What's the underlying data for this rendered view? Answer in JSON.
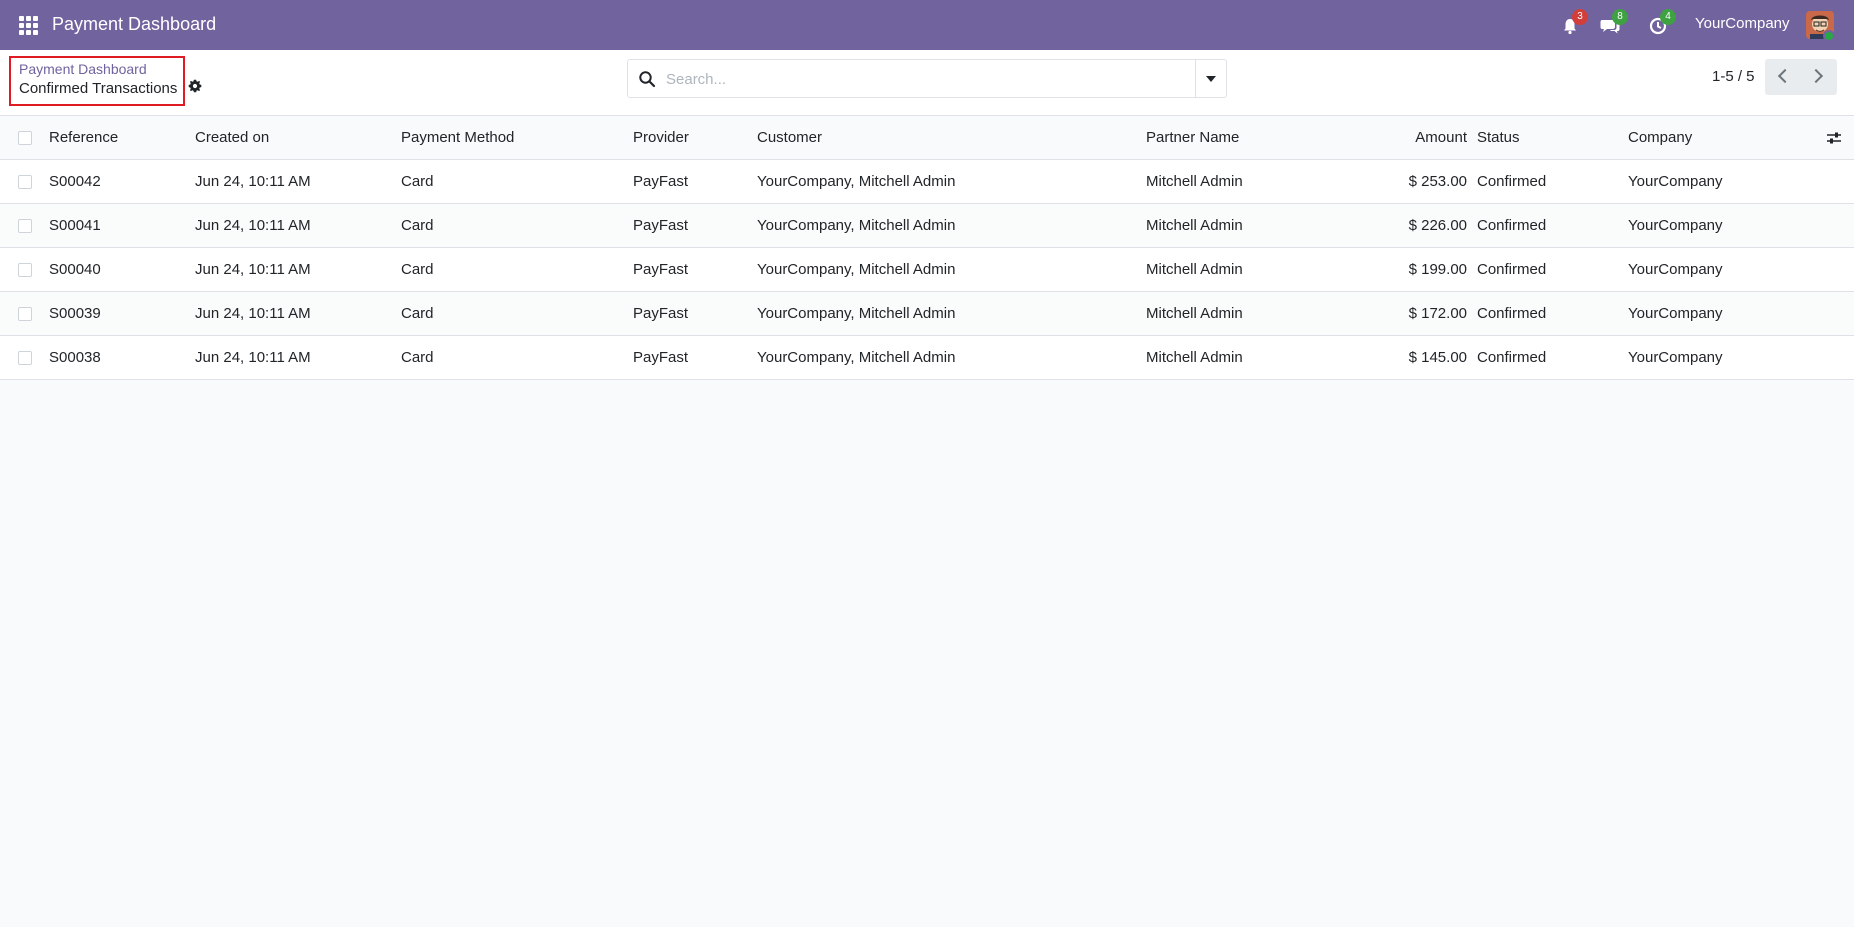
{
  "navbar": {
    "app_title": "Payment Dashboard",
    "icons": [
      "apps-icon",
      "bell-icon",
      "chat-icon",
      "clock-icon"
    ],
    "notifications_count": "3",
    "messages_count": "8",
    "activities_count": "4",
    "company": "YourCompany",
    "bg_color": "#71639e"
  },
  "breadcrumb": {
    "parent": "Payment Dashboard",
    "current": "Confirmed Transactions"
  },
  "search": {
    "placeholder": "Search...",
    "value": ""
  },
  "pager": {
    "value": "1-5 / 5"
  },
  "table": {
    "columns": [
      "Reference",
      "Created on",
      "Payment Method",
      "Provider",
      "Customer",
      "Partner Name",
      "Amount",
      "Status",
      "Company"
    ],
    "rows": [
      {
        "reference": "S00042",
        "created_on": "Jun 24, 10:11 AM",
        "payment_method": "Card",
        "provider": "PayFast",
        "customer": "YourCompany, Mitchell Admin",
        "partner_name": "Mitchell Admin",
        "amount": "$ 253.00",
        "status": "Confirmed",
        "company": "YourCompany"
      },
      {
        "reference": "S00041",
        "created_on": "Jun 24, 10:11 AM",
        "payment_method": "Card",
        "provider": "PayFast",
        "customer": "YourCompany, Mitchell Admin",
        "partner_name": "Mitchell Admin",
        "amount": "$ 226.00",
        "status": "Confirmed",
        "company": "YourCompany"
      },
      {
        "reference": "S00040",
        "created_on": "Jun 24, 10:11 AM",
        "payment_method": "Card",
        "provider": "PayFast",
        "customer": "YourCompany, Mitchell Admin",
        "partner_name": "Mitchell Admin",
        "amount": "$ 199.00",
        "status": "Confirmed",
        "company": "YourCompany"
      },
      {
        "reference": "S00039",
        "created_on": "Jun 24, 10:11 AM",
        "payment_method": "Card",
        "provider": "PayFast",
        "customer": "YourCompany, Mitchell Admin",
        "partner_name": "Mitchell Admin",
        "amount": "$ 172.00",
        "status": "Confirmed",
        "company": "YourCompany"
      },
      {
        "reference": "S00038",
        "created_on": "Jun 24, 10:11 AM",
        "payment_method": "Card",
        "provider": "PayFast",
        "customer": "YourCompany, Mitchell Admin",
        "partner_name": "Mitchell Admin",
        "amount": "$ 145.00",
        "status": "Confirmed",
        "company": "YourCompany"
      }
    ]
  }
}
